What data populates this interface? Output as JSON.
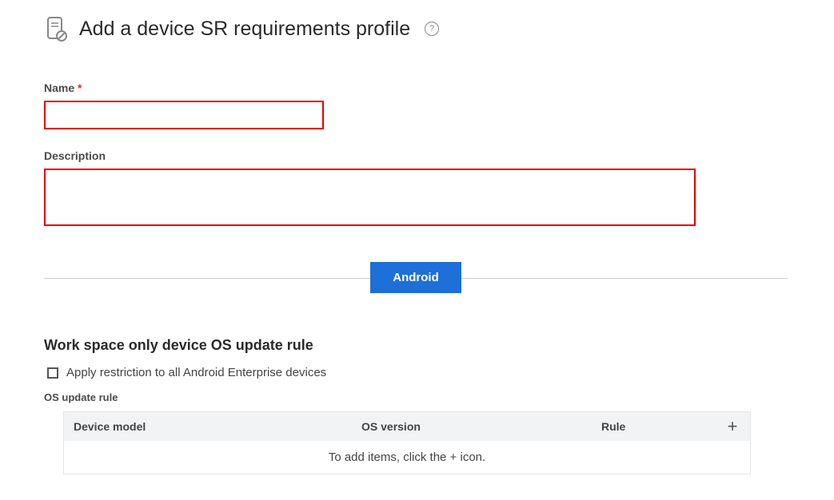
{
  "header": {
    "title": "Add a device SR requirements profile"
  },
  "form": {
    "name_label": "Name",
    "name_value": "",
    "description_label": "Description",
    "description_value": ""
  },
  "tab": {
    "label": "Android"
  },
  "section": {
    "title": "Work space only device OS update rule",
    "checkbox_label": "Apply restriction to all Android Enterprise devices",
    "sub_label": "OS update rule"
  },
  "table": {
    "headers": {
      "device_model": "Device model",
      "os_version": "OS version",
      "rule": "Rule"
    },
    "empty_message": "To add items, click the + icon."
  }
}
